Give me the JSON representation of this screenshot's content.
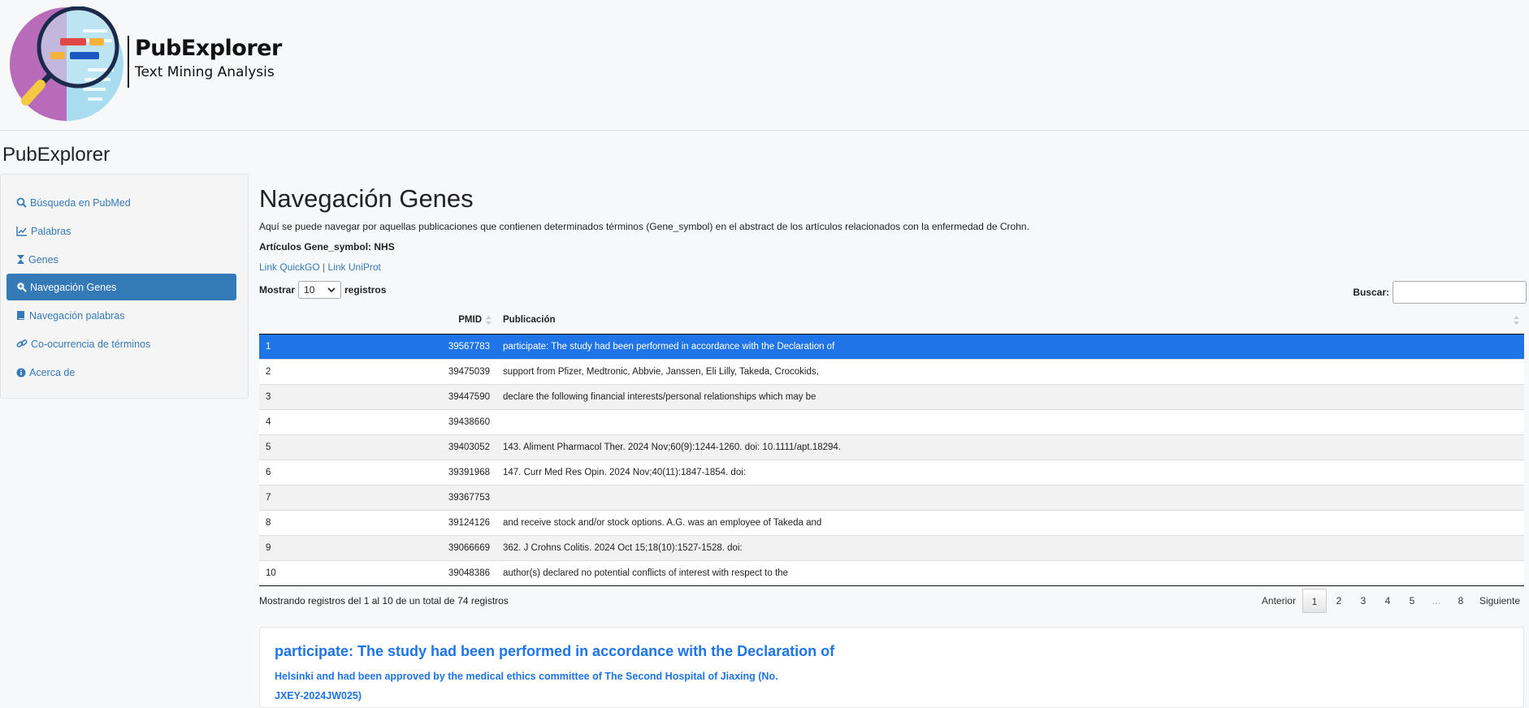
{
  "header": {
    "logo_title": "PubExplorer",
    "logo_subtitle": "Text Mining Analysis"
  },
  "app_title": "PubExplorer",
  "sidebar": {
    "items": [
      {
        "label": "Búsqueda en PubMed",
        "icon": "search-icon",
        "active": false
      },
      {
        "label": "Palabras",
        "icon": "chart-line-icon",
        "active": false
      },
      {
        "label": "Genes",
        "icon": "hourglass-icon",
        "active": false
      },
      {
        "label": "Navegación Genes",
        "icon": "search-plus-icon",
        "active": true
      },
      {
        "label": "Navegación palabras",
        "icon": "book-icon",
        "active": false
      },
      {
        "label": "Co-ocurrencia de términos",
        "icon": "link-icon",
        "active": false
      },
      {
        "label": "Acerca de",
        "icon": "info-circle-icon",
        "active": false
      }
    ]
  },
  "main": {
    "heading": "Navegación Genes",
    "description": "Aquí se puede navegar por aquellas publicaciones que contienen determinados términos (Gene_symbol) en el abstract de los artículos relacionados con la enfermedad de Crohn.",
    "gene_label": "Artículos Gene_symbol: NHS",
    "links": {
      "quickgo": "Link QuickGO",
      "separator": "|",
      "uniprot": "Link UniProt"
    },
    "length": {
      "prefix": "Mostrar",
      "value": "10",
      "suffix": "registros"
    },
    "search": {
      "label": "Buscar:",
      "value": ""
    },
    "table": {
      "headers": {
        "index": "",
        "pmid": "PMID",
        "publication": "Publicación"
      },
      "rows": [
        {
          "index": "1",
          "pmid": "39567783",
          "text": "participate: The study had been performed in accordance with the Declaration of",
          "selected": true
        },
        {
          "index": "2",
          "pmid": "39475039",
          "text": "support from Pfizer, Medtronic, Abbvie, Janssen, Eli Lilly, Takeda, Crocokids,",
          "selected": false
        },
        {
          "index": "3",
          "pmid": "39447590",
          "text": "declare the following financial interests/personal relationships which may be",
          "selected": false
        },
        {
          "index": "4",
          "pmid": "39438660",
          "text": "",
          "selected": false
        },
        {
          "index": "5",
          "pmid": "39403052",
          "text": "143. Aliment Pharmacol Ther. 2024 Nov;60(9):1244-1260. doi: 10.1111/apt.18294.",
          "selected": false
        },
        {
          "index": "6",
          "pmid": "39391968",
          "text": "147. Curr Med Res Opin. 2024 Nov;40(11):1847-1854. doi:",
          "selected": false
        },
        {
          "index": "7",
          "pmid": "39367753",
          "text": "",
          "selected": false
        },
        {
          "index": "8",
          "pmid": "39124126",
          "text": "and receive stock and/or stock options. A.G. was an employee of Takeda and",
          "selected": false
        },
        {
          "index": "9",
          "pmid": "39066669",
          "text": "362. J Crohns Colitis. 2024 Oct 15;18(10):1527-1528. doi:",
          "selected": false
        },
        {
          "index": "10",
          "pmid": "39048386",
          "text": "author(s) declared no potential conflicts of interest with respect to the",
          "selected": false
        }
      ]
    },
    "info": "Mostrando registros del 1 al 10 de un total de 74 registros",
    "pagination": {
      "previous": "Anterior",
      "pages": [
        "1",
        "2",
        "3",
        "4",
        "5",
        "…",
        "8"
      ],
      "current": "1",
      "next": "Siguiente"
    },
    "article": {
      "title": "participate: The study had been performed in accordance with the Declaration of",
      "subtitle": "Helsinki and had been approved by the medical ethics committee of The Second Hospital of Jiaxing (No.",
      "subtitle2": "JXEY-2024JW025)"
    }
  },
  "colors": {
    "accent": "#337ab7",
    "selected_row": "#1f74e8",
    "article_link": "#1f74e8"
  }
}
